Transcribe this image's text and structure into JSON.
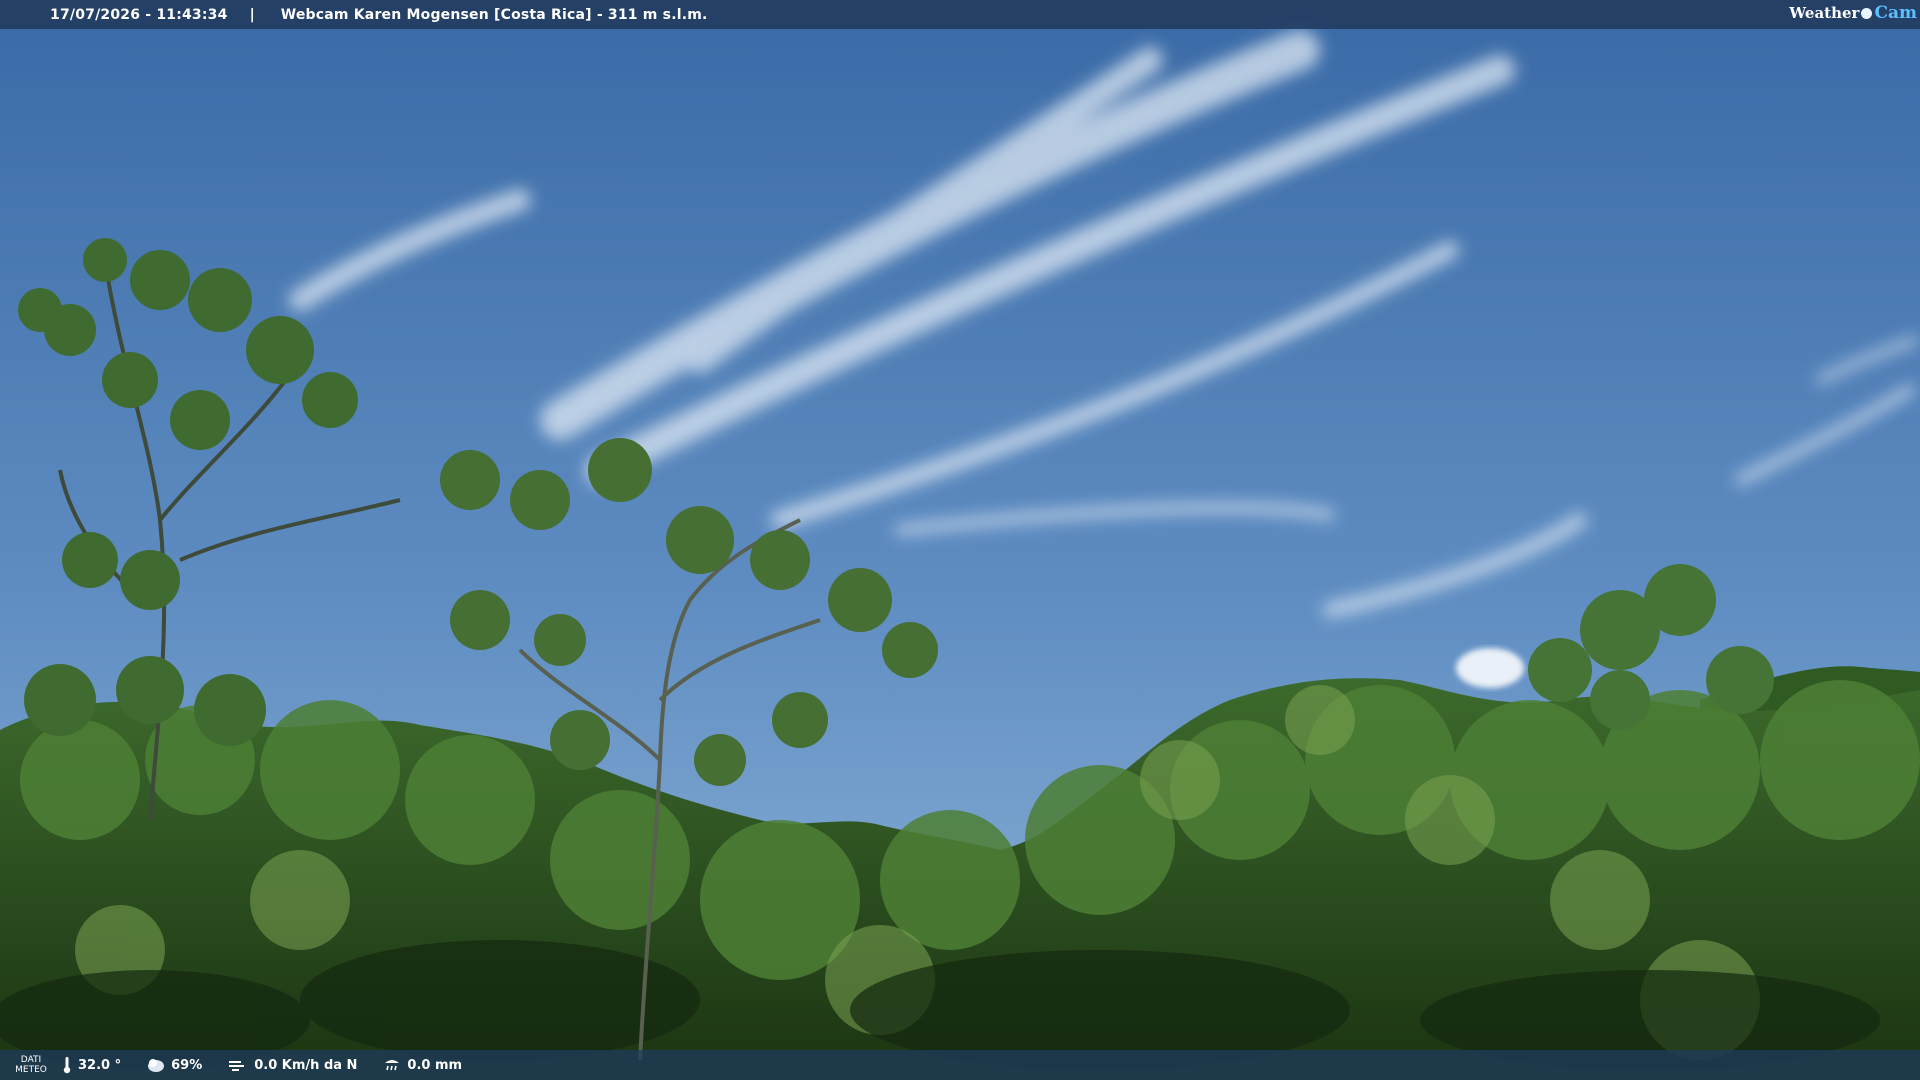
{
  "header": {
    "datetime": "17/07/2026 - 11:43:34",
    "separator": "|",
    "camera_title": "Webcam Karen Mogensen [Costa Rica] - 311 m s.l.m.",
    "brand_part1": "Weather",
    "brand_part2": "Cam"
  },
  "weather": {
    "section_label_line1": "DATI",
    "section_label_line2": "METEO",
    "temperature": "32.0 °",
    "humidity": "69%",
    "wind": "0.0 Km/h da N",
    "rain": "0.0 mm",
    "icons": [
      "thermometer-icon",
      "humidity-icon",
      "wind-icon",
      "rain-gauge-icon"
    ]
  },
  "colors": {
    "sky_top": "#3a6aa6",
    "sky_bottom": "#86aed6",
    "foliage_dark": "#1f3a16",
    "foliage_mid": "#3b6a2a",
    "foliage_light": "#6a9648",
    "bar_bg": "#213a5f",
    "brand_accent": "#5cc0ff"
  }
}
